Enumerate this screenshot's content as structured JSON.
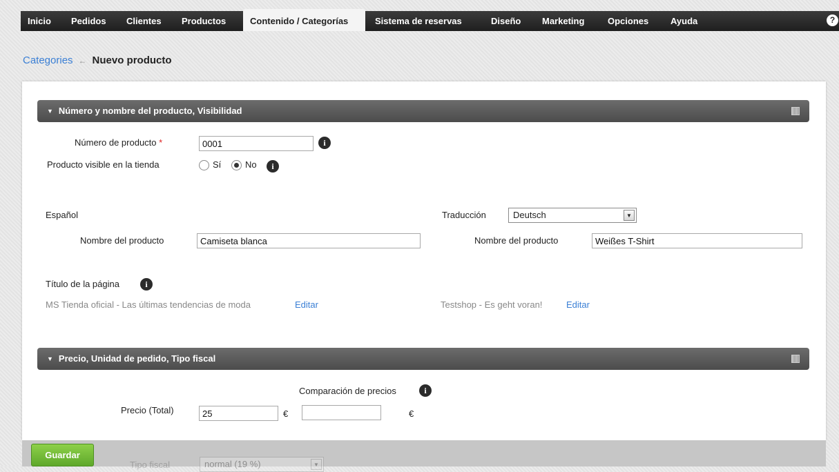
{
  "nav": {
    "items": [
      "Inicio",
      "Pedidos",
      "Clientes",
      "Productos",
      "Contenido / Categorías",
      "Sistema de reservas",
      "Diseño",
      "Marketing",
      "Opciones",
      "Ayuda"
    ],
    "active_index": 4,
    "help_icon": "?"
  },
  "breadcrumb": {
    "parent": "Categories",
    "separator": "←",
    "current": "Nuevo producto"
  },
  "section1": {
    "title": "Número y nombre del producto, Visibilidad",
    "product_number_label": "Número de producto",
    "required_mark": "*",
    "product_number_value": "0001",
    "visible_label": "Producto visible en la tienda",
    "visible_options": [
      "Sí",
      "No"
    ],
    "visible_selected": "No",
    "lang_label": "Español",
    "translation_label": "Traducción",
    "translation_value": "Deutsch",
    "name_label": "Nombre del producto",
    "name_value": "Camiseta blanca",
    "name_label_translated": "Nombre del producto",
    "name_value_translated": "Weißes T-Shirt",
    "page_title_label": "Título de la página",
    "page_title_value": "MS Tienda oficial - Las últimas tendencias de moda",
    "page_title_edit": "Editar",
    "page_title_value_translated": "Testshop - Es geht voran!",
    "page_title_edit_translated": "Editar"
  },
  "section2": {
    "title": "Precio, Unidad de pedido, Tipo fiscal",
    "compare_label": "Comparación de precios",
    "price_label": "Precio (Total)",
    "price_value": "25",
    "currency": "€",
    "compare_value": "",
    "compare_currency": "€",
    "tax_label": "Tipo fiscal",
    "tax_value": "normal (19 %)"
  },
  "footer": {
    "save_label": "Guardar"
  },
  "colors": {
    "accent_link": "#3a7fd5",
    "save_green": "#6bb532",
    "header_dark": "#555555",
    "required": "#dd2222"
  }
}
